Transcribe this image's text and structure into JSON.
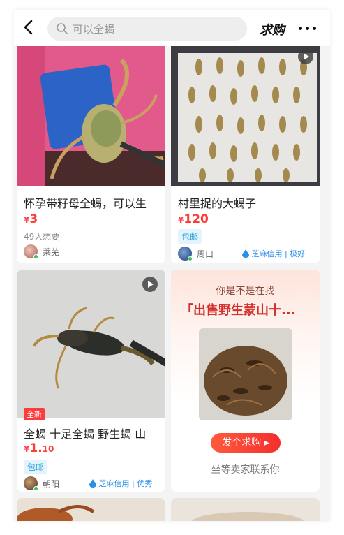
{
  "header": {
    "search_placeholder": "可以全蝎",
    "qiugou_label": "求购"
  },
  "cards": [
    {
      "title": "怀孕带籽母全蝎，可以生",
      "price_symbol": "¥",
      "price_int": "3",
      "price_dec": "",
      "wants": "49人想要",
      "seller": "莱芜"
    },
    {
      "title": "村里捉的大蝎子",
      "price_symbol": "¥",
      "price_int": "120",
      "price_dec": "",
      "tag": "包邮",
      "seller": "周口",
      "credit": "芝麻信用 | 极好"
    },
    {
      "badge": "全新",
      "title": "全蝎  十足全蝎 野生蝎 山",
      "price_symbol": "¥",
      "price_int": "1.",
      "price_dec": "10",
      "tag": "包邮",
      "seller": "朝阳",
      "credit": "芝麻信用 | 优秀"
    }
  ],
  "promo": {
    "question": "你是不是在找",
    "keyword": "「出售野生蒙山十...",
    "button": "发个求购 ▸",
    "wait_text": "坐等卖家联系你"
  },
  "colors": {
    "price": "#ff3c3c",
    "accent_blue": "#2a8fe8",
    "tag_bg": "#e3f4fd"
  }
}
